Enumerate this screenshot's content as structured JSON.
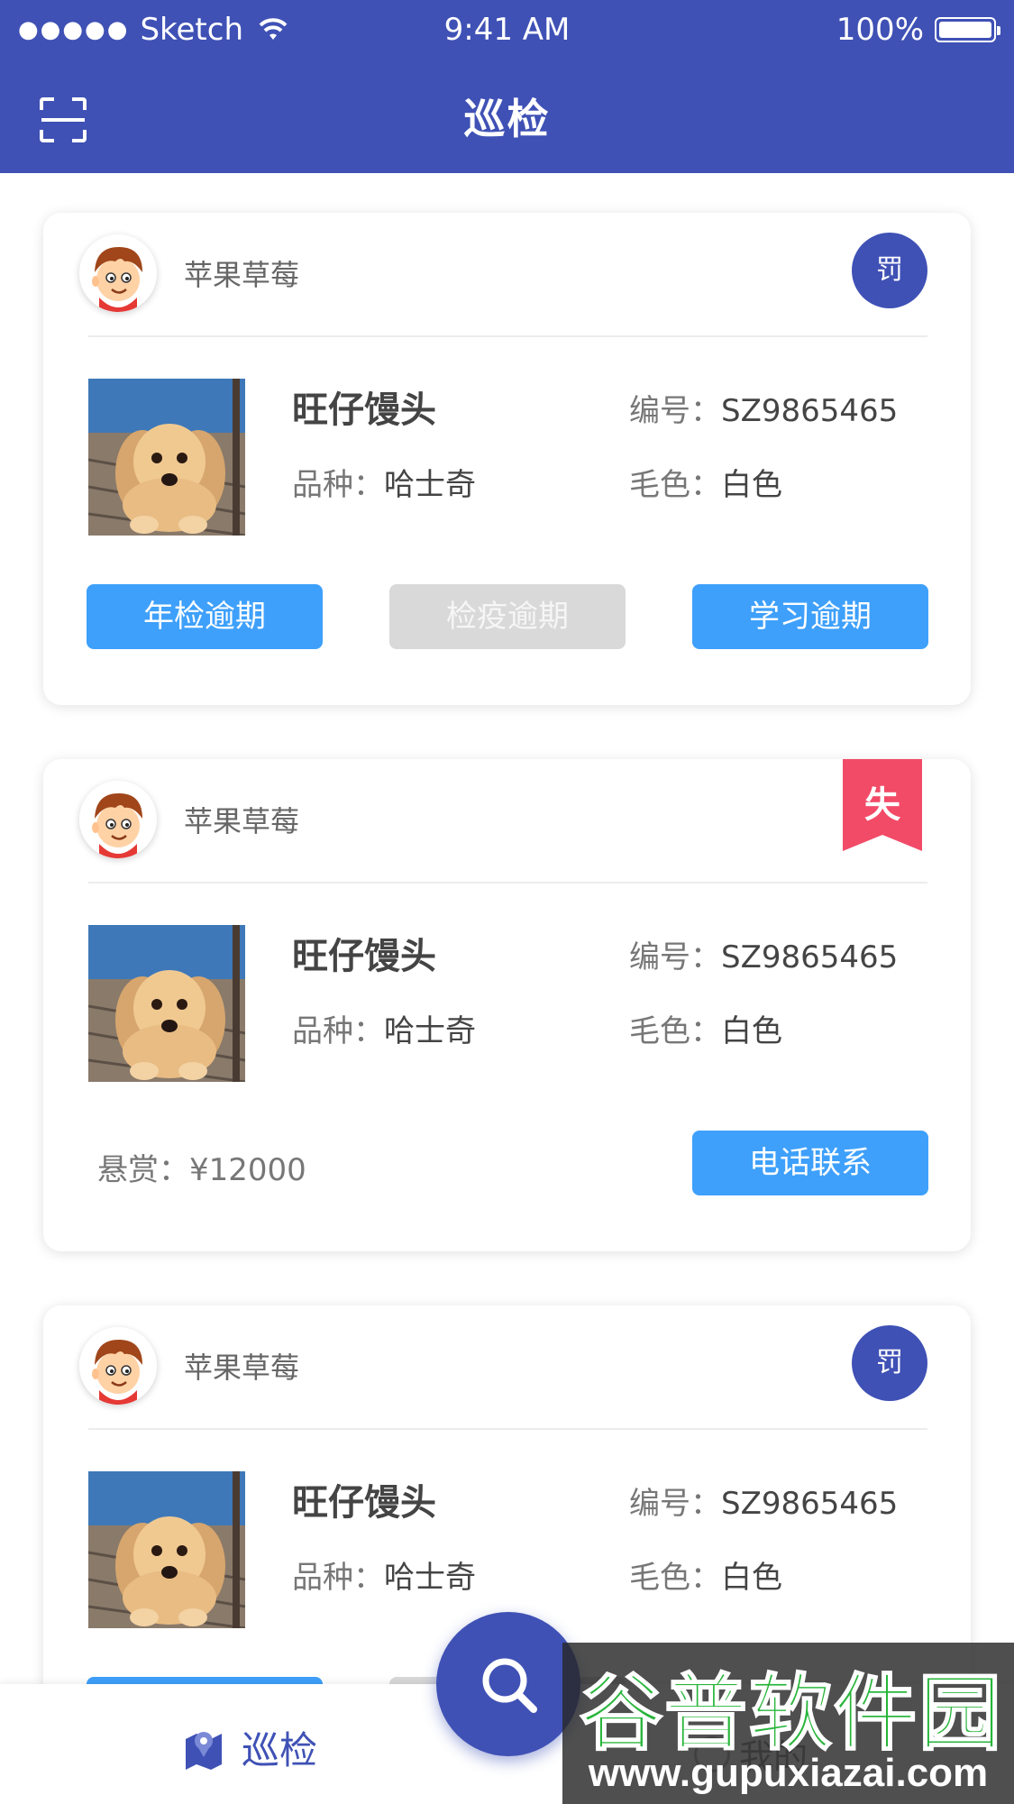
{
  "status_bar": {
    "carrier": "Sketch",
    "time": "9:41 AM",
    "battery": "100%"
  },
  "header": {
    "title": "巡检",
    "scan_icon": "scan-icon"
  },
  "colors": {
    "primary": "#3f51b5",
    "button_blue": "#3ea0fb",
    "button_gray": "#d9d9d9",
    "lost_red": "#f24b68"
  },
  "cards": [
    {
      "owner": "苹果草莓",
      "badge": "罚",
      "pet_name": "旺仔馒头",
      "breed_label": "品种：",
      "breed": "哈士奇",
      "id_label": "编号：",
      "id": "SZ9865465",
      "color_label": "毛色：",
      "color": "白色",
      "buttons": [
        "年检逾期",
        "检疫逾期",
        "学习逾期"
      ]
    },
    {
      "owner": "苹果草莓",
      "badge": "失",
      "pet_name": "旺仔馒头",
      "breed_label": "品种：",
      "breed": "哈士奇",
      "id_label": "编号：",
      "id": "SZ9865465",
      "color_label": "毛色：",
      "color": "白色",
      "reward_label": "悬赏：",
      "reward": "¥12000",
      "call_button": "电话联系"
    },
    {
      "owner": "苹果草莓",
      "badge": "罚",
      "pet_name": "旺仔馒头",
      "breed_label": "品种：",
      "breed": "哈士奇",
      "id_label": "编号：",
      "id": "SZ9865465",
      "color_label": "毛色：",
      "color": "白色"
    }
  ],
  "tabbar": {
    "patrol": "巡检",
    "mine": "我的"
  },
  "watermark": {
    "line1": "谷普软件园",
    "line2": "www.gupuxiazai.com"
  }
}
